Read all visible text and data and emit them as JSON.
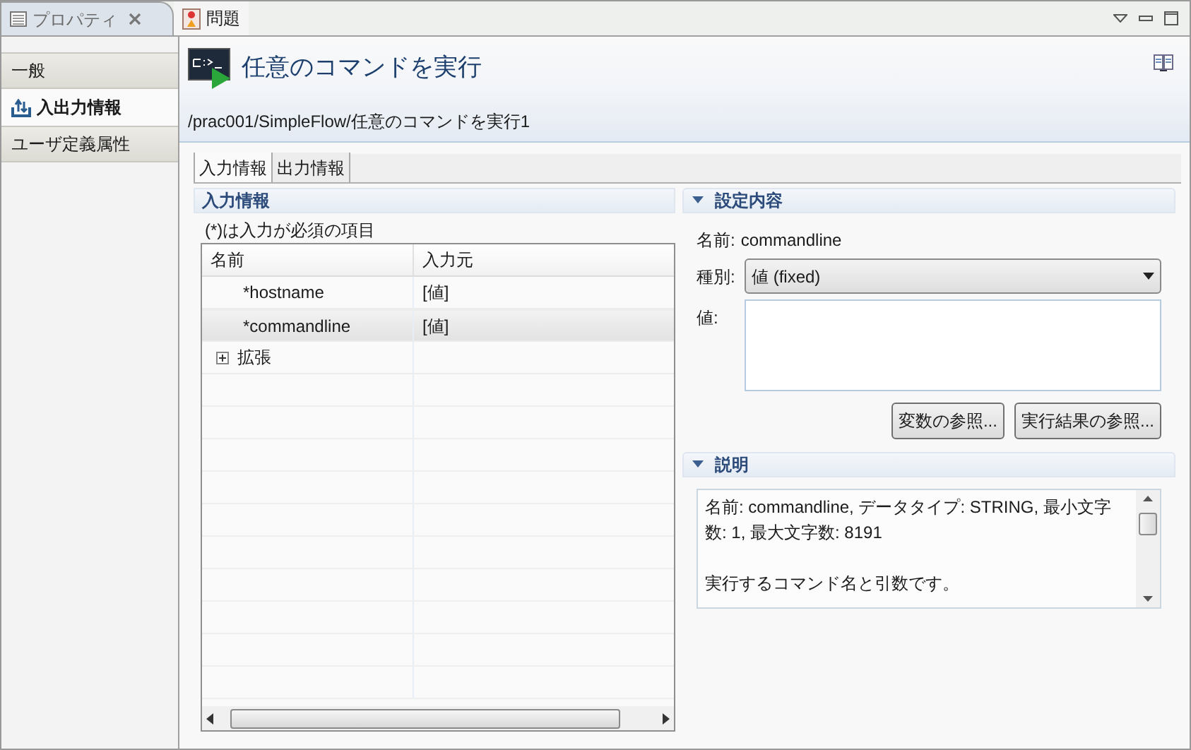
{
  "view_tabs": [
    {
      "label": "プロパティ",
      "selected": true,
      "closable": true,
      "kind": "properties"
    },
    {
      "label": "問題",
      "selected": false,
      "closable": false,
      "kind": "problems"
    }
  ],
  "sidebar": {
    "items": [
      {
        "label": "一般",
        "selected": false
      },
      {
        "label": "入出力情報",
        "selected": true
      },
      {
        "label": "ユーザ定義属性",
        "selected": false
      }
    ]
  },
  "header": {
    "title": "任意のコマンドを実行",
    "path": "/prac001/SimpleFlow/任意のコマンドを実行1"
  },
  "tabs": [
    {
      "label": "入力情報",
      "selected": true
    },
    {
      "label": "出力情報",
      "selected": false
    }
  ],
  "input_panel": {
    "title": "入力情報",
    "note": "(*)は入力が必須の項目",
    "columns": [
      "名前",
      "入力元"
    ],
    "rows": [
      {
        "kind": "param",
        "name": "*hostname",
        "source": "[値]",
        "selected": false
      },
      {
        "kind": "param",
        "name": "*commandline",
        "source": "[値]",
        "selected": true
      },
      {
        "kind": "group",
        "name": "拡張",
        "selected": false,
        "expanded": false
      }
    ]
  },
  "settings": {
    "title": "設定内容",
    "expanded": true,
    "name_label": "名前:",
    "name_value": "commandline",
    "type_label": "種別:",
    "type_value": "値 (fixed)",
    "value_label": "値:",
    "buttons": [
      "変数の参照...",
      "実行結果の参照..."
    ]
  },
  "description": {
    "title": "説明",
    "expanded": true,
    "paragraphs": [
      "名前: commandline, データタイプ: STRING, 最小文字数: 1, 最大文字数: 8191",
      "実行するコマンド名と引数です。"
    ]
  }
}
